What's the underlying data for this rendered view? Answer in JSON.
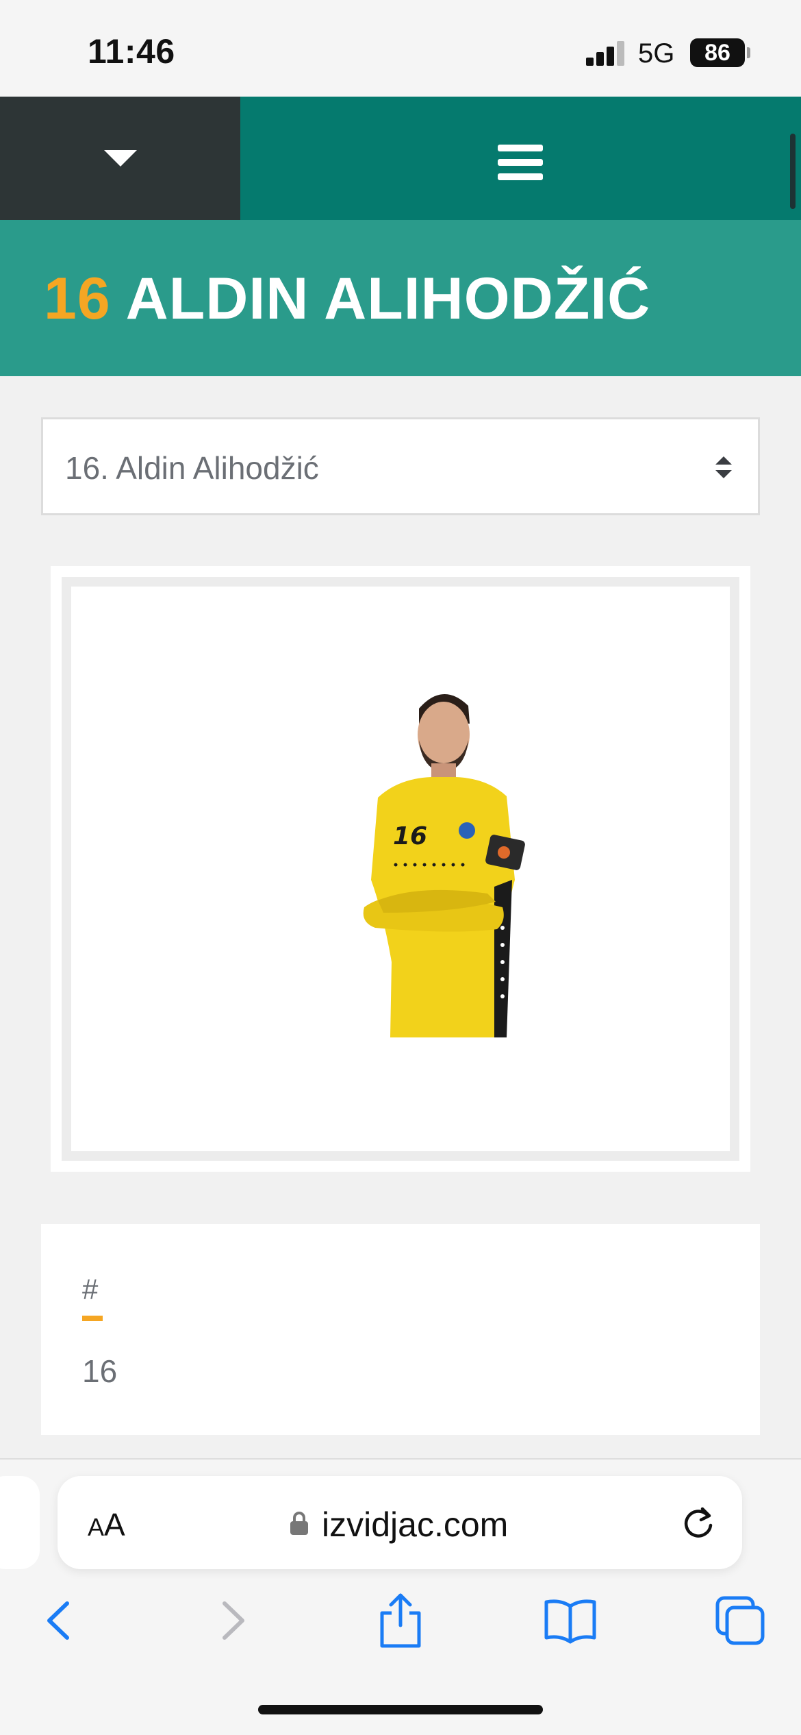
{
  "status_bar": {
    "time": "11:46",
    "network": "5G",
    "battery": "86"
  },
  "nav": {
    "dropdown_icon": "caret-down-icon",
    "menu_icon": "hamburger-menu-icon"
  },
  "player": {
    "number": "16",
    "name": "ALDIN ALIHODŽIĆ"
  },
  "select": {
    "value": "16. Aldin Alihodžić",
    "icon": "sort-arrows-icon"
  },
  "info": {
    "label": "#",
    "value": "16"
  },
  "browser": {
    "text_size_label_small": "A",
    "text_size_label_large": "A",
    "url": "izvidjac.com",
    "icons": [
      "lock-icon",
      "reload-icon",
      "back-icon",
      "forward-icon",
      "share-icon",
      "bookmarks-icon",
      "tabs-icon"
    ]
  },
  "colors": {
    "accent": "#f5a623",
    "nav_dark": "#2d3536",
    "nav_teal": "#057a6e",
    "title_teal": "#2a9b8b",
    "browser_blue": "#1a7cf5"
  }
}
